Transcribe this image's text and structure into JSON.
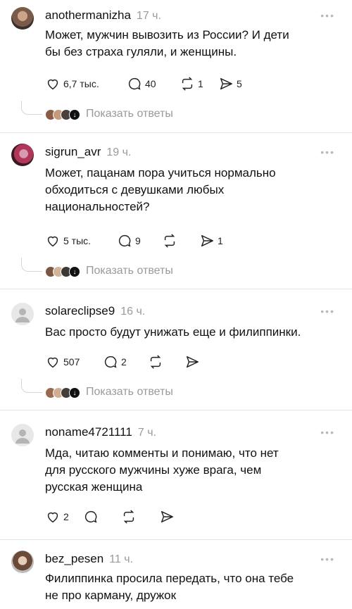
{
  "colors": {
    "text": "#111111",
    "muted": "#9a9a9a",
    "separator": "#e4e4e4"
  },
  "icons": {
    "like": "heart-outline-icon",
    "comment": "speech-bubble-icon",
    "repost": "repost-arrows-icon",
    "share": "send-arrow-icon",
    "more": "ellipsis-icon"
  },
  "show_replies_label": "Показать ответы",
  "posts": [
    {
      "username": "anothermanizha",
      "time": "17 ч.",
      "more": "•••",
      "lines": [
        "Может, мужчин вывозить из России? И дети",
        "бы без страха гуляли, и женщины."
      ],
      "likes": "6,7 тыс.",
      "comments": "40",
      "reposts": "1",
      "shares": "5",
      "has_replies": true
    },
    {
      "username": "sigrun_avr",
      "time": "19 ч.",
      "more": "•••",
      "lines": [
        "Может, пацанам пора учиться нормально",
        "обходиться с девушками любых",
        "национальностей?"
      ],
      "likes": "5 тыс.",
      "comments": "9",
      "reposts": "",
      "shares": "1",
      "has_replies": true
    },
    {
      "username": "solareclipse9",
      "time": "16 ч.",
      "more": "•••",
      "lines": [
        "Вас просто будут унижать еще и филиппинки."
      ],
      "likes": "507",
      "comments": "2",
      "reposts": "",
      "shares": "",
      "has_replies": true
    },
    {
      "username": "noname4721111",
      "time": "7 ч.",
      "more": "•••",
      "lines": [
        "Мда, читаю комменты и понимаю, что нет",
        "для русского мужчины хуже врага, чем",
        "русская женщина"
      ],
      "likes": "2",
      "comments": "",
      "reposts": "",
      "shares": "",
      "has_replies": false
    },
    {
      "username": "bez_pesen",
      "time": "11 ч.",
      "more": "•••",
      "lines": [
        "Филиппинка просила передать, что она тебе",
        "не про карману, дружок"
      ],
      "likes": "",
      "comments": "",
      "reposts": "",
      "shares": "",
      "has_replies": false
    }
  ]
}
